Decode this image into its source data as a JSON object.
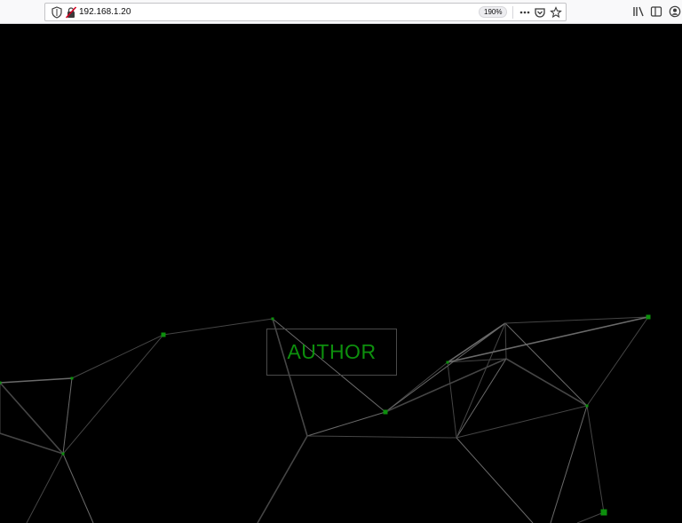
{
  "browser": {
    "url": "192.168.1.20",
    "zoom": "190%"
  },
  "page": {
    "background": "#000000",
    "accent": "#0d8f0d",
    "button_label": "AUTHOR"
  },
  "icons": {
    "urlbar": [
      "shield-icon",
      "insecure-lock-icon",
      "more-actions-icon",
      "pocket-icon",
      "bookmark-star-icon"
    ],
    "toolbar": [
      "library-icon",
      "sidebar-icon",
      "account-icon"
    ]
  }
}
